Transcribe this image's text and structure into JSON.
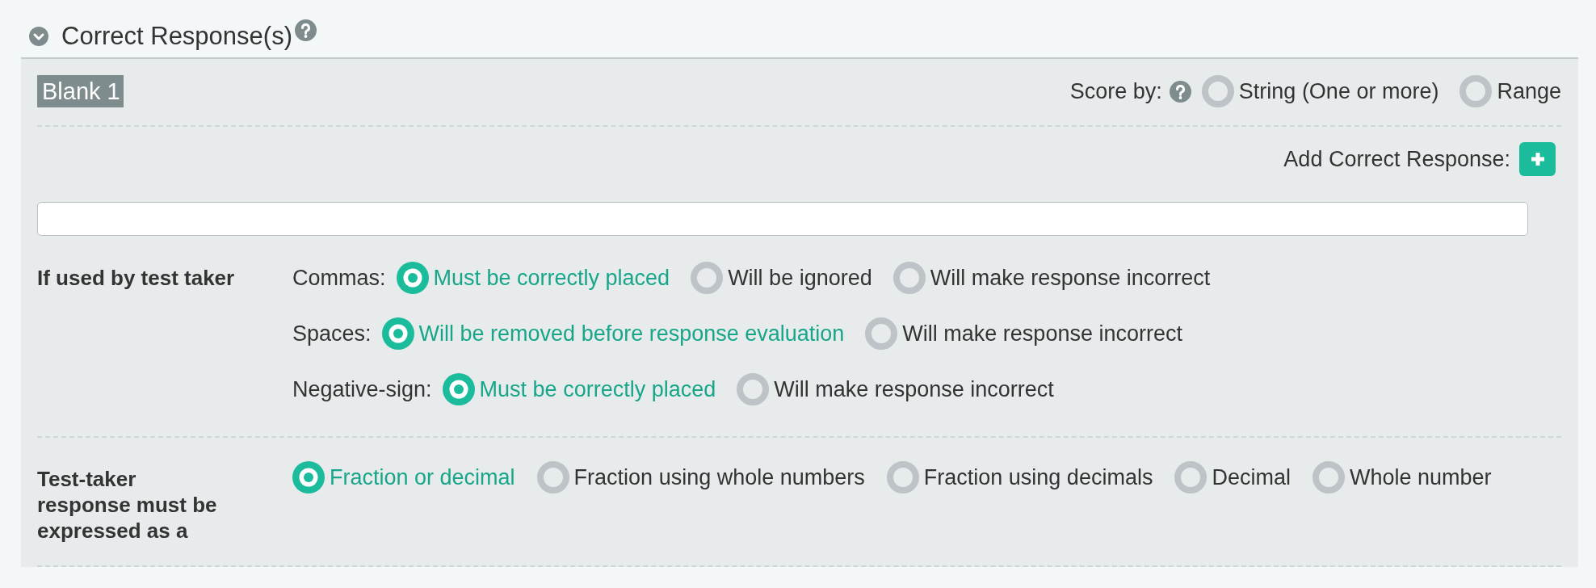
{
  "section": {
    "title": "Correct Response(s)",
    "expanded": true
  },
  "blank": {
    "label": "Blank 1"
  },
  "score_by": {
    "label": "Score by:",
    "options": [
      {
        "label": "String (One or more)",
        "selected": false
      },
      {
        "label": "Range",
        "selected": false
      }
    ]
  },
  "add_response": {
    "label": "Add Correct Response:"
  },
  "usage": {
    "label": "If used by test taker",
    "rules": [
      {
        "label": "Commas:",
        "options": [
          {
            "label": "Must be correctly placed",
            "selected": true
          },
          {
            "label": "Will be ignored",
            "selected": false
          },
          {
            "label": "Will make response incorrect",
            "selected": false
          }
        ]
      },
      {
        "label": "Spaces:",
        "options": [
          {
            "label": "Will be removed before response evaluation",
            "selected": true
          },
          {
            "label": "Will make response incorrect",
            "selected": false
          }
        ]
      },
      {
        "label": "Negative-sign:",
        "options": [
          {
            "label": "Must be correctly placed",
            "selected": true
          },
          {
            "label": "Will make response incorrect",
            "selected": false
          }
        ]
      }
    ]
  },
  "expression": {
    "label": "Test-taker response must be expressed as a",
    "options": [
      {
        "label": "Fraction or decimal",
        "selected": true
      },
      {
        "label": "Fraction using whole numbers",
        "selected": false
      },
      {
        "label": "Fraction using decimals",
        "selected": false
      },
      {
        "label": "Decimal",
        "selected": false
      },
      {
        "label": "Whole number",
        "selected": false
      }
    ]
  }
}
